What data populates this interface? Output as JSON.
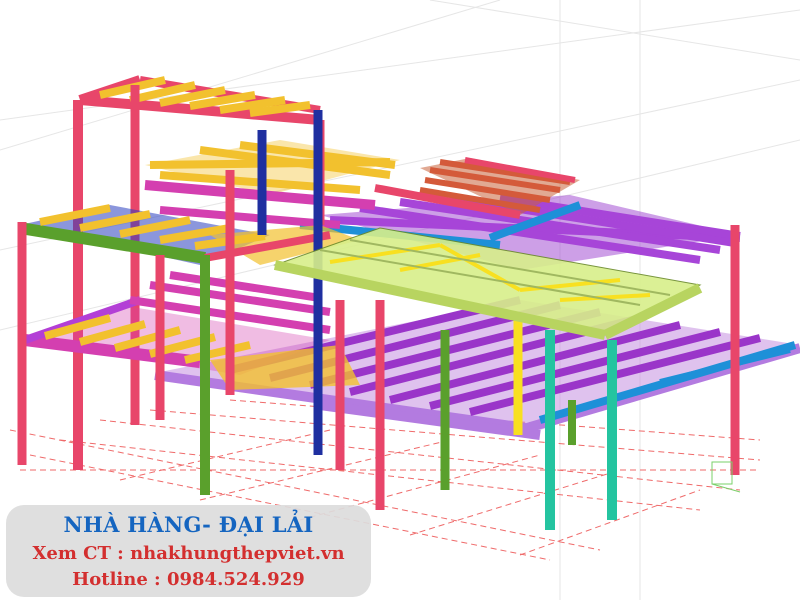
{
  "caption": {
    "title": "NHÀ HÀNG- ĐẠI LẢI",
    "link": "Xem CT : nhakhungthepviet.vn",
    "hotline": "Hotline : 0984.524.929"
  },
  "colors": {
    "column_red": "#e8466a",
    "column_blue": "#1f2fa0",
    "column_green": "#5aa02c",
    "column_teal": "#24c4a0",
    "beam_orange": "#f2c12e",
    "beam_purple": "#b33fd6",
    "beam_magenta": "#d43fb0",
    "slab_lime": "#d8ef8a",
    "beam_cyan": "#1e90d8",
    "brace_yellow": "#f8e020"
  }
}
